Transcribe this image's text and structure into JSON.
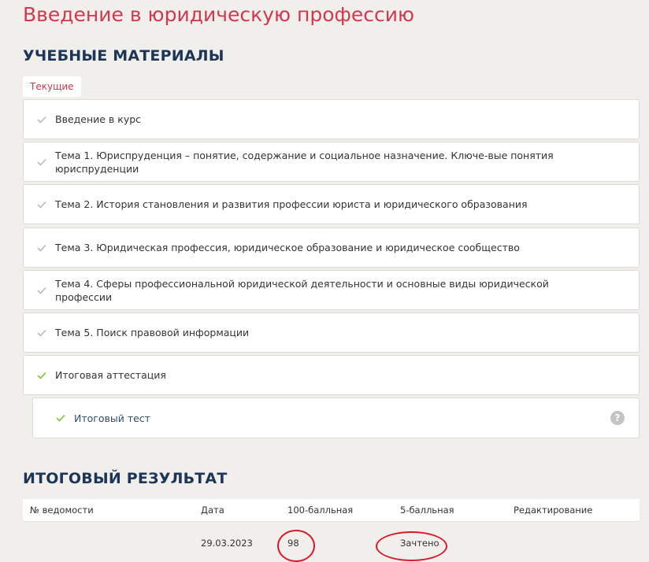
{
  "page": {
    "title": "Введение в юридическую профессию"
  },
  "materials": {
    "title": "УЧЕБНЫЕ МАТЕРИАЛЫ",
    "tab_current": "Текущие",
    "items": [
      {
        "label": "Введение в курс",
        "check_color": "#b9b9b9"
      },
      {
        "label": "Тема 1. Юриспруденция – понятие, содержание и социальное назначение. Ключе-вые понятия юриспруденции",
        "check_color": "#b9b9b9"
      },
      {
        "label": "Тема 2. История становления и развития профессии юриста и юридического образования",
        "check_color": "#b9b9b9"
      },
      {
        "label": "Тема 3. Юридическая профессия, юридическое образование и юридическое сообщество",
        "check_color": "#b9b9b9"
      },
      {
        "label": "Тема 4. Сферы профессиональной юридической деятельности и основные виды юридической профессии",
        "check_color": "#b9b9b9"
      },
      {
        "label": "Тема 5. Поиск правовой информации",
        "check_color": "#b9b9b9"
      },
      {
        "label": "Итоговая аттестация",
        "check_color": "#8cc63f"
      }
    ],
    "subitem": {
      "label": "Итоговый тест",
      "check_color": "#8cc63f",
      "help_icon": "question-circle-icon",
      "help_glyph": "?"
    }
  },
  "results": {
    "title": "ИТОГОВЫЙ РЕЗУЛЬТАТ",
    "columns": [
      "№ ведомости",
      "Дата",
      "100-балльная",
      "5-балльная",
      "Редактирование"
    ],
    "rows": [
      {
        "statement_no": "",
        "date": "29.03.2023",
        "score_100": "98",
        "score_5": "Зачтено",
        "edit": ""
      }
    ]
  },
  "colors": {
    "accent": "#d0384f",
    "heading": "#1d3557",
    "annotation": "#d81a2a"
  }
}
